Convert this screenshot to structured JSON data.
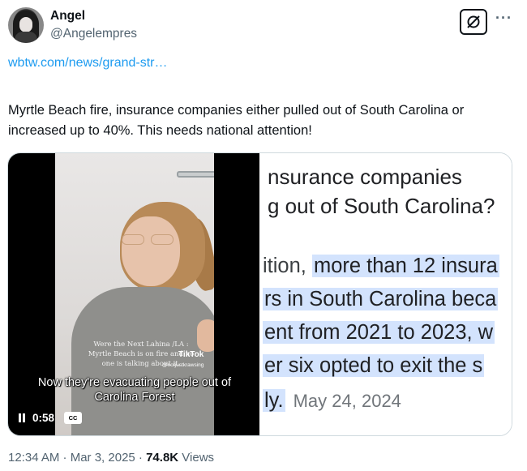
{
  "author": {
    "display_name": "Angel",
    "handle": "@Angelempres"
  },
  "tweet": {
    "link": "wbtw.com/news/grand-str…",
    "text": "Myrtle Beach fire, insurance companies either pulled out of South Carolina or increased up to 40%. This needs national attention!"
  },
  "video": {
    "overlay_caption": "Were the Next Lahina /LA : Myrtle Beach is on fire and no one is talking about it.",
    "watermark": "TikTok",
    "watermark_user": "@notjustkrawsing",
    "subtitle": "Now they're evacuating people out of Carolina Forest",
    "time": "0:58",
    "cc_label": "CC"
  },
  "article": {
    "head_line1": "nsurance companies",
    "head_line2": "g out of South Carolina?",
    "line1_plain": "ition, ",
    "line1_hl": "more than 12 insura",
    "line2_hl": "rs in South Carolina beca",
    "line3_hl": "ent from 2021 to 2023, w",
    "line4_hl": "er six opted to exit the s",
    "line5_hl": "ly.",
    "date": "May 24, 2024"
  },
  "meta": {
    "timestamp": "12:34 AM · Mar 3, 2025 · ",
    "views_count": "74.8K",
    "views_label": " Views"
  },
  "colors": {
    "link": "#1d9bf0",
    "secondary_text": "#536471",
    "highlight": "#d3e3fd"
  },
  "icons": [
    "grok-icon",
    "more-icon",
    "pause-icon",
    "cc-icon"
  ]
}
